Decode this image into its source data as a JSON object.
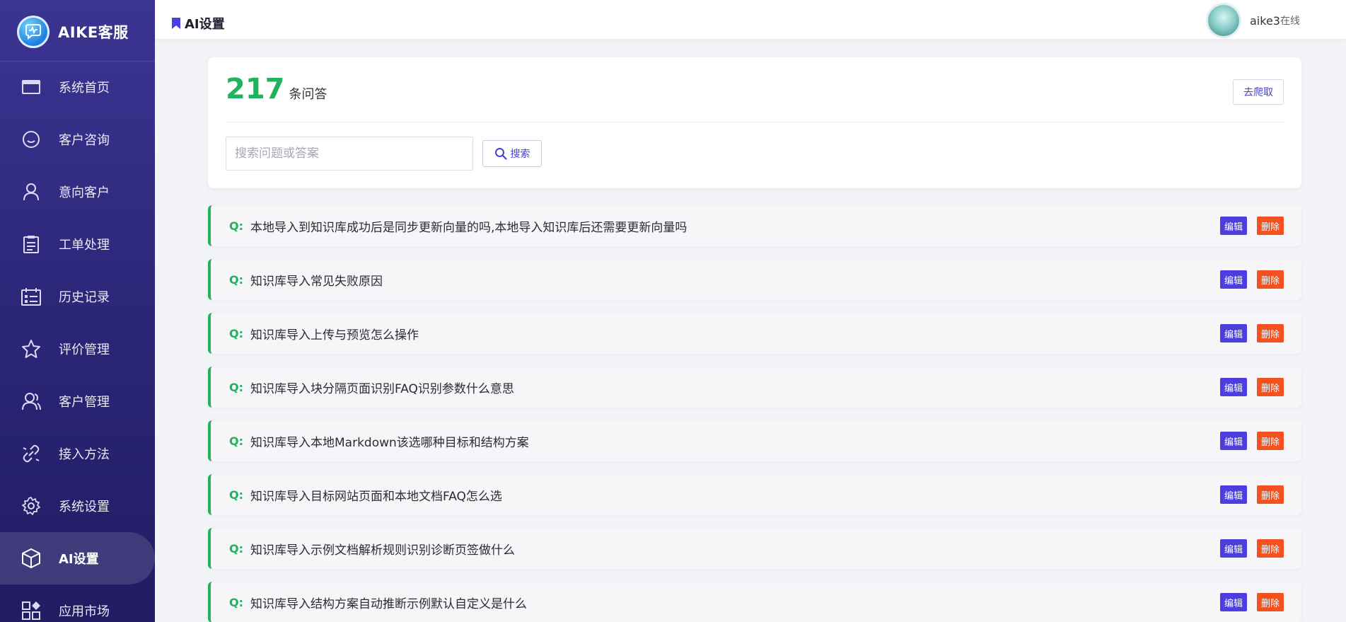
{
  "brand": {
    "name": "AIKE客服"
  },
  "sidebar": {
    "items": [
      {
        "label": "系统首页",
        "icon": "window-icon"
      },
      {
        "label": "客户咨询",
        "icon": "chat-bubble-icon"
      },
      {
        "label": "意向客户",
        "icon": "user-icon"
      },
      {
        "label": "工单处理",
        "icon": "clipboard-icon"
      },
      {
        "label": "历史记录",
        "icon": "calendar-list-icon"
      },
      {
        "label": "评价管理",
        "icon": "star-icon"
      },
      {
        "label": "客户管理",
        "icon": "users-icon"
      },
      {
        "label": "接入方法",
        "icon": "link-icon"
      },
      {
        "label": "系统设置",
        "icon": "gear-icon"
      },
      {
        "label": "AI设置",
        "icon": "cube-icon",
        "active": true
      },
      {
        "label": "应用市场",
        "icon": "apps-icon"
      }
    ]
  },
  "header": {
    "title": "AI设置",
    "user": {
      "name": "aike3",
      "status": "在线"
    }
  },
  "summary": {
    "count": "217",
    "unit": "条问答",
    "crawl_label": "去爬取",
    "search_placeholder": "搜索问题或答案",
    "search_label": "搜索"
  },
  "qa": {
    "prefix": "Q:",
    "edit_label": "编辑",
    "delete_label": "删除",
    "items": [
      "本地导入到知识库成功后是同步更新向量的吗,本地导入知识库后还需要更新向量吗",
      "知识库导入常见失败原因",
      "知识库导入上传与预览怎么操作",
      "知识库导入块分隔页面识别FAQ识别参数什么意思",
      "知识库导入本地Markdown该选哪种目标和结构方案",
      "知识库导入目标网站页面和本地文档FAQ怎么选",
      "知识库导入示例文档解析规则识别诊断页签做什么",
      "知识库导入结构方案自动推断示例默认自定义是什么"
    ]
  },
  "colors": {
    "accent": "#4d3ee0",
    "success": "#22b25f",
    "danger": "#f4511e",
    "sidebar_bg": "#2a2576"
  }
}
